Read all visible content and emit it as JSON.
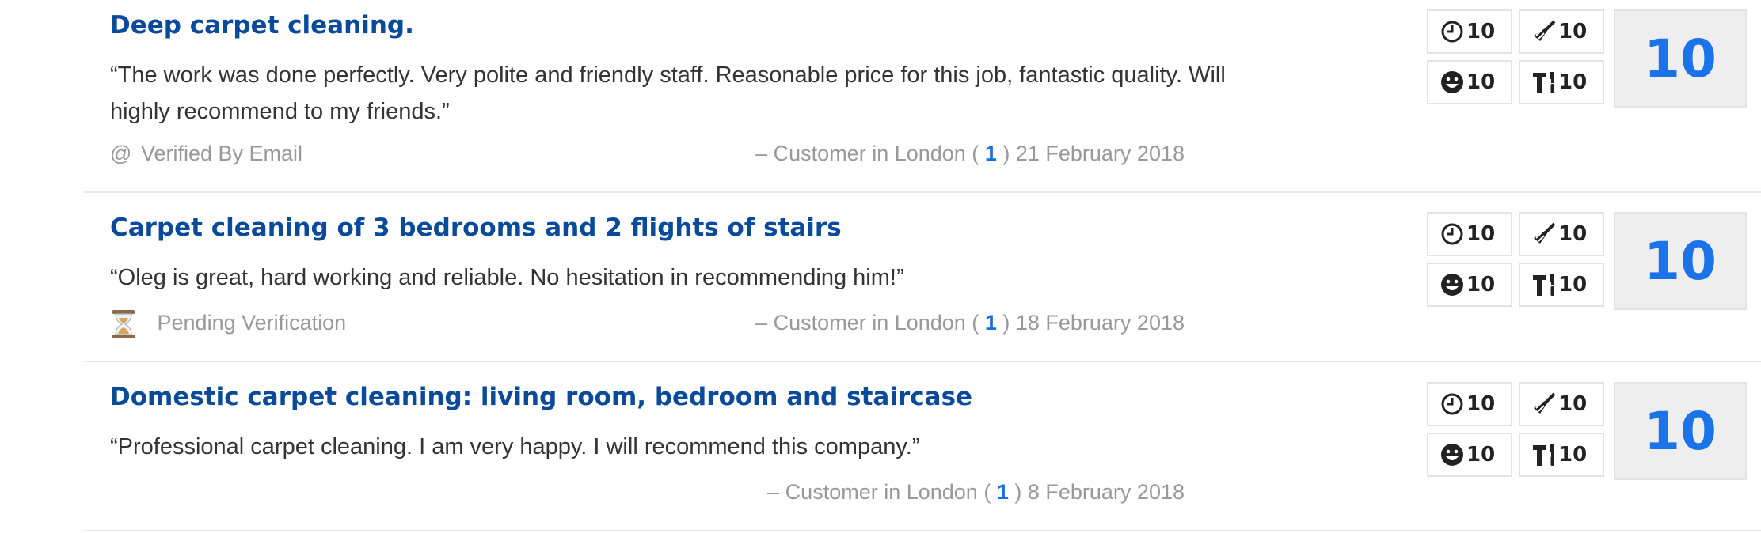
{
  "reviews": [
    {
      "title": "Deep carpet cleaning.",
      "quote": "“The work was done perfectly. Very polite and friendly staff. Reasonable price for this job, fantastic quality. Will highly recommend to my friends.”",
      "verification": "Verified By Email",
      "verification_icon": "at-icon",
      "attribution_prefix": "– Customer in London (",
      "count": "1",
      "attribution_suffix": ") 21 February 2018",
      "scores": {
        "time": "10",
        "cleanliness": "10",
        "courtesy": "10",
        "workmanship": "10"
      },
      "overall": "10"
    },
    {
      "title": "Carpet cleaning of 3 bedrooms and 2 flights of stairs",
      "quote": "“Oleg is great, hard working and reliable. No hesitation in recommending him!”",
      "verification": "Pending Verification",
      "verification_icon": "hourglass-icon",
      "attribution_prefix": "– Customer in London (",
      "count": "1",
      "attribution_suffix": ") 18 February 2018",
      "scores": {
        "time": "10",
        "cleanliness": "10",
        "courtesy": "10",
        "workmanship": "10"
      },
      "overall": "10"
    },
    {
      "title": "Domestic carpet cleaning: living room, bedroom and staircase",
      "quote": "“Professional carpet cleaning. I am very happy. I will recommend this company.”",
      "verification": "",
      "attribution_prefix": "– Customer in London (",
      "count": "1",
      "attribution_suffix": ") 8 February 2018",
      "scores": {
        "time": "10",
        "cleanliness": "10",
        "courtesy": "10",
        "workmanship": "10"
      },
      "overall": "10"
    }
  ],
  "colors": {
    "title": "#0a4a9b",
    "overall_score": "#1a73e8",
    "count": "#1a6fe0",
    "muted": "#999999"
  },
  "icons": {
    "time": "clock-icon",
    "cleanliness": "broom-icon",
    "courtesy": "smiley-icon",
    "workmanship": "tools-icon"
  }
}
